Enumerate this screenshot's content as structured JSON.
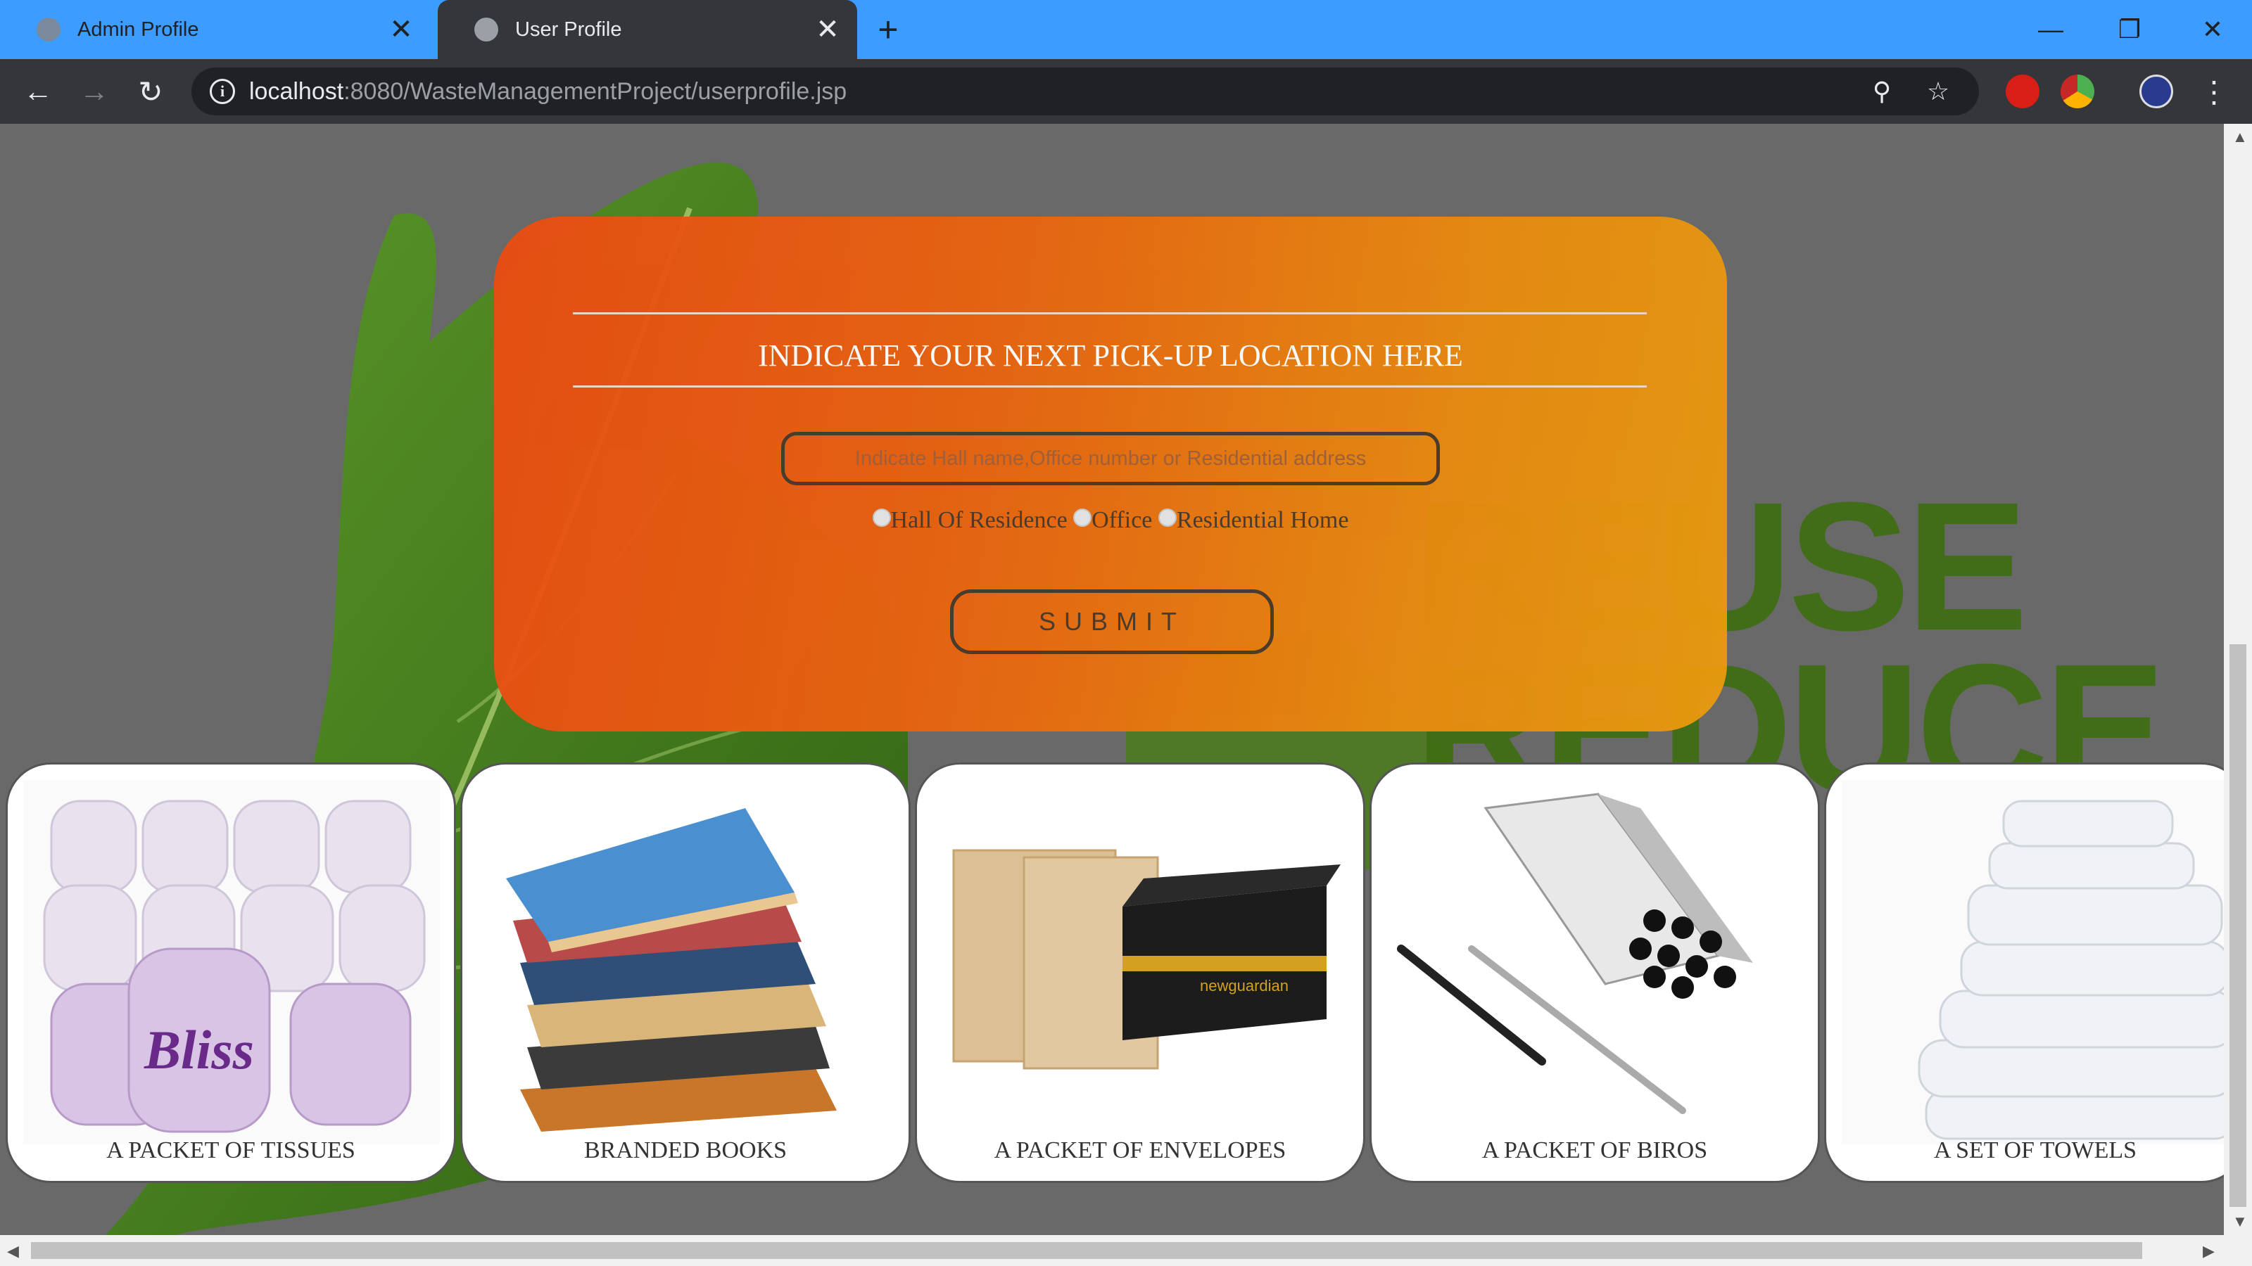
{
  "browser": {
    "tabs": [
      {
        "title": "Admin Profile",
        "active": false
      },
      {
        "title": "User Profile",
        "active": true
      }
    ],
    "url_host": "localhost",
    "url_rest": ":8080/WasteManagementProject/userprofile.jsp"
  },
  "background": {
    "words": [
      "REUSE",
      "REDUCE"
    ]
  },
  "form": {
    "title": "INDICATE YOUR NEXT PICK-UP LOCATION HERE",
    "placeholder": "Indicate Hall name,Office number or Residential address",
    "options": [
      "Hall Of Residence",
      "Office",
      "Residential Home"
    ],
    "submit_label": "SUBMIT"
  },
  "products": [
    {
      "label": "A PACKET OF TISSUES"
    },
    {
      "label": "BRANDED BOOKS"
    },
    {
      "label": "A PACKET OF ENVELOPES"
    },
    {
      "label": "A PACKET OF BIROS"
    },
    {
      "label": "A SET OF TOWELS"
    }
  ],
  "colors": {
    "tabbar": "#3c9cff",
    "toolbar": "#35363a",
    "form_gradient_start": "#e94c12",
    "form_gradient_end": "#e89a0e",
    "page_background": "#696969"
  }
}
